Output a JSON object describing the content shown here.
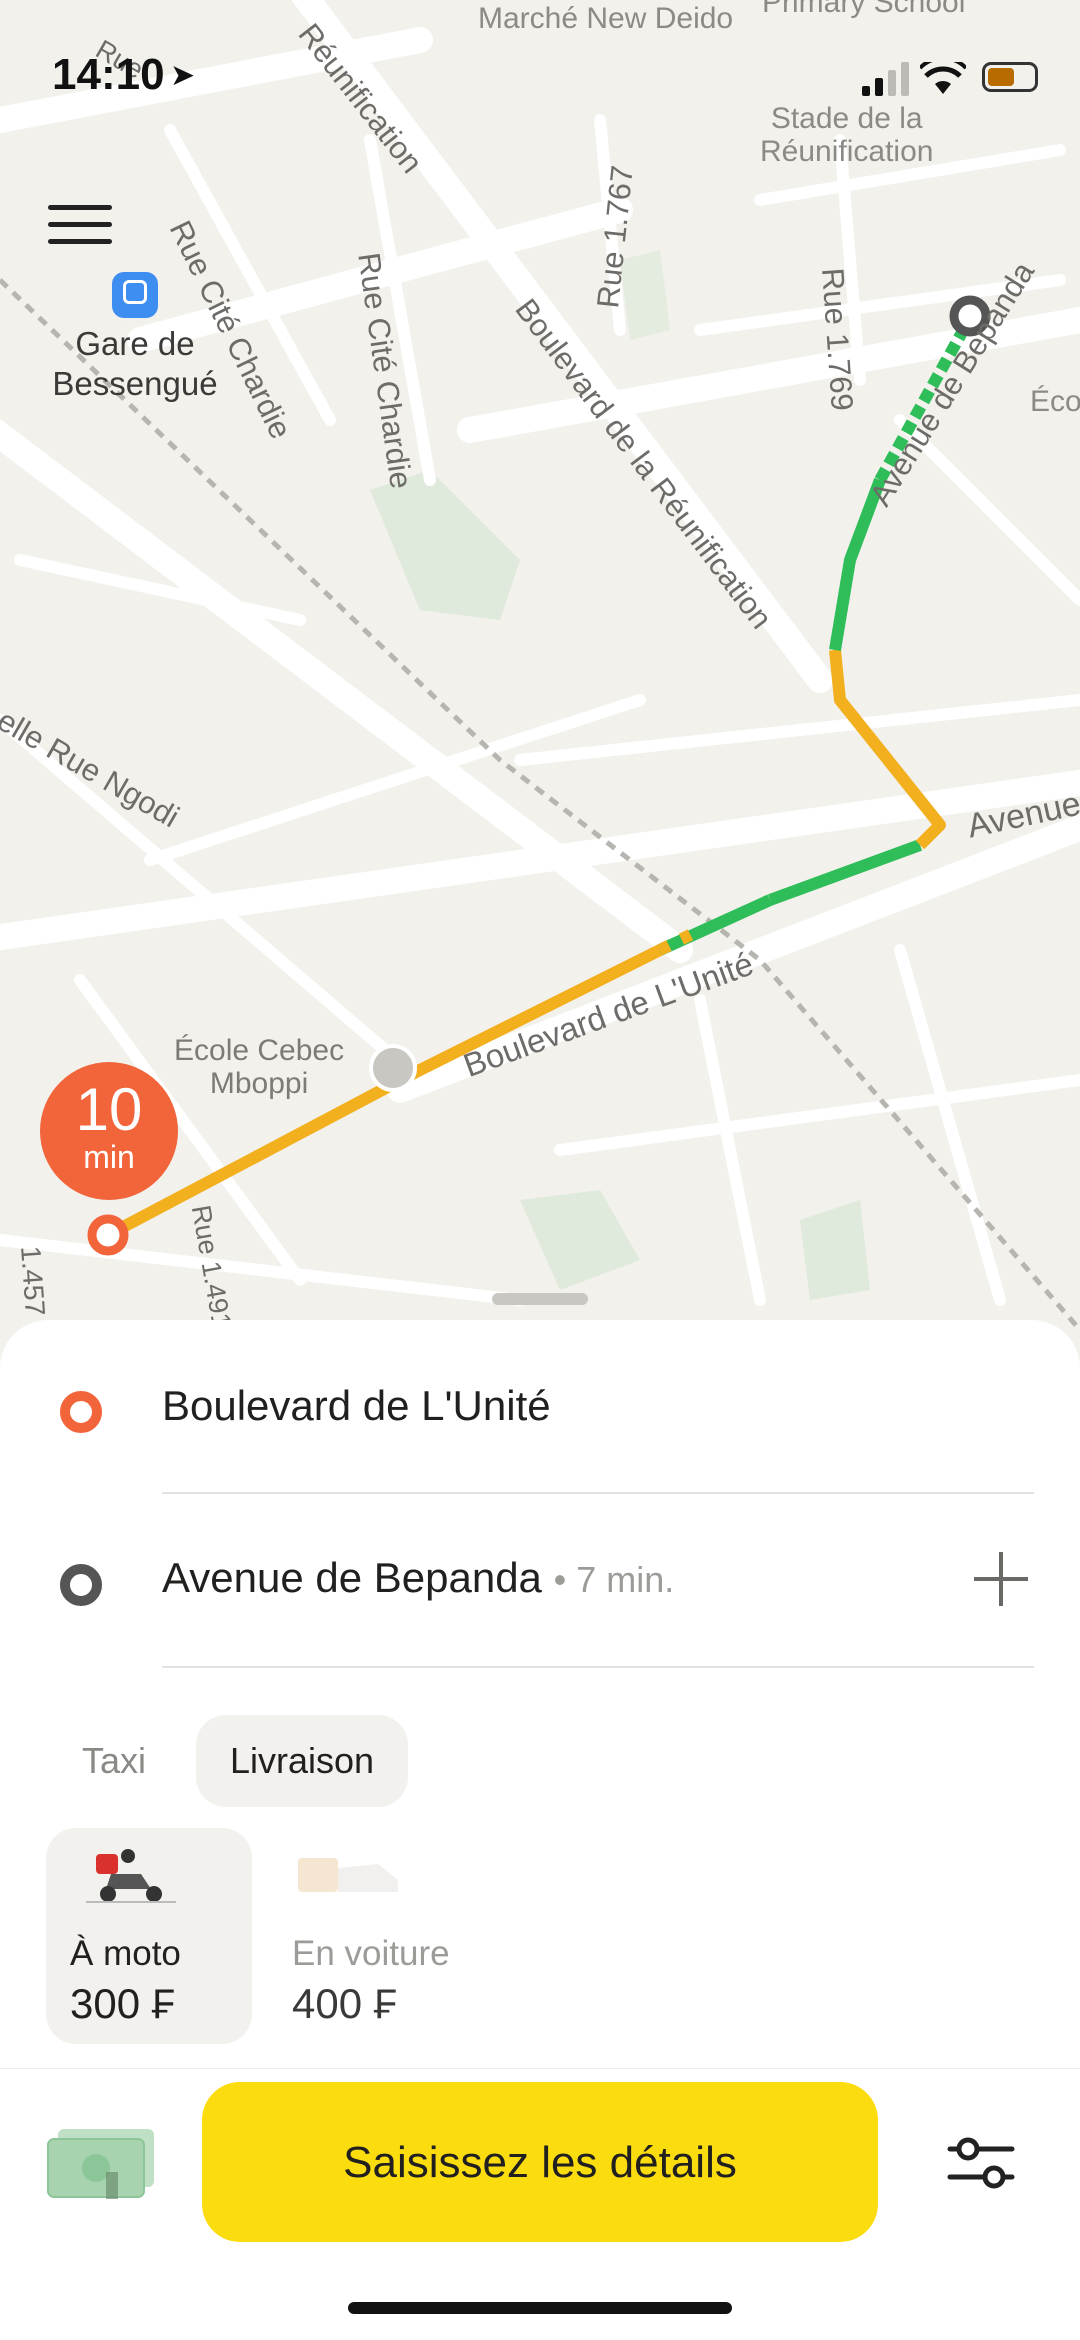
{
  "status_bar": {
    "time": "14:10"
  },
  "map": {
    "labels": {
      "marche": "Marché\nNew Deido",
      "primary_school": "Primary School",
      "stade": "Stade de la\nRéunification",
      "gare": "Gare de\nBessengué",
      "ecole": "École Cebec\nMboppi",
      "eco": "Éco"
    },
    "streets": {
      "rue_cite_chardie_1": "Rue Cité Chardie",
      "rue_cite_chardie_2": "Rue Cité Chardie",
      "reunification_top": "Réunification",
      "boulevard_reunification": "Boulevard de la Réunification",
      "rue_1767": "Rue 1.767",
      "rue_1769": "Rue 1.769",
      "avenue_bepanda": "Avenue de Bepanda",
      "avenue_right": "Avenue",
      "rue_ngodi": "elle Rue Ngodi",
      "boulevard_unite": "Boulevard de L'Unité",
      "rue_1457": "1.457",
      "rue_1491": "Rue 1.491",
      "rue_top_left": "Rue"
    },
    "eta": {
      "value": "10",
      "unit": "min"
    }
  },
  "route": {
    "pickup": "Boulevard de L'Unité",
    "destination": "Avenue de Bepanda",
    "destination_eta": "• 7 min."
  },
  "tabs": [
    {
      "label": "Taxi",
      "selected": false
    },
    {
      "label": "Livraison",
      "selected": true
    }
  ],
  "tariffs": [
    {
      "name": "À moto",
      "price": "300 ₣",
      "selected": true,
      "icon": "moto-courier-icon"
    },
    {
      "name": "En voiture",
      "price": "400 ₣",
      "selected": false,
      "icon": "car-delivery-icon"
    }
  ],
  "footer": {
    "payment_icon": "cash-icon",
    "cta_label": "Saisissez les détails",
    "settings_icon": "sliders-icon"
  },
  "colors": {
    "accent_yellow": "#fbdd0f",
    "pickup_orange": "#f2643a",
    "route_green": "#2ebd59",
    "route_yellow": "#f2b01e",
    "destination_gray": "#555555"
  }
}
